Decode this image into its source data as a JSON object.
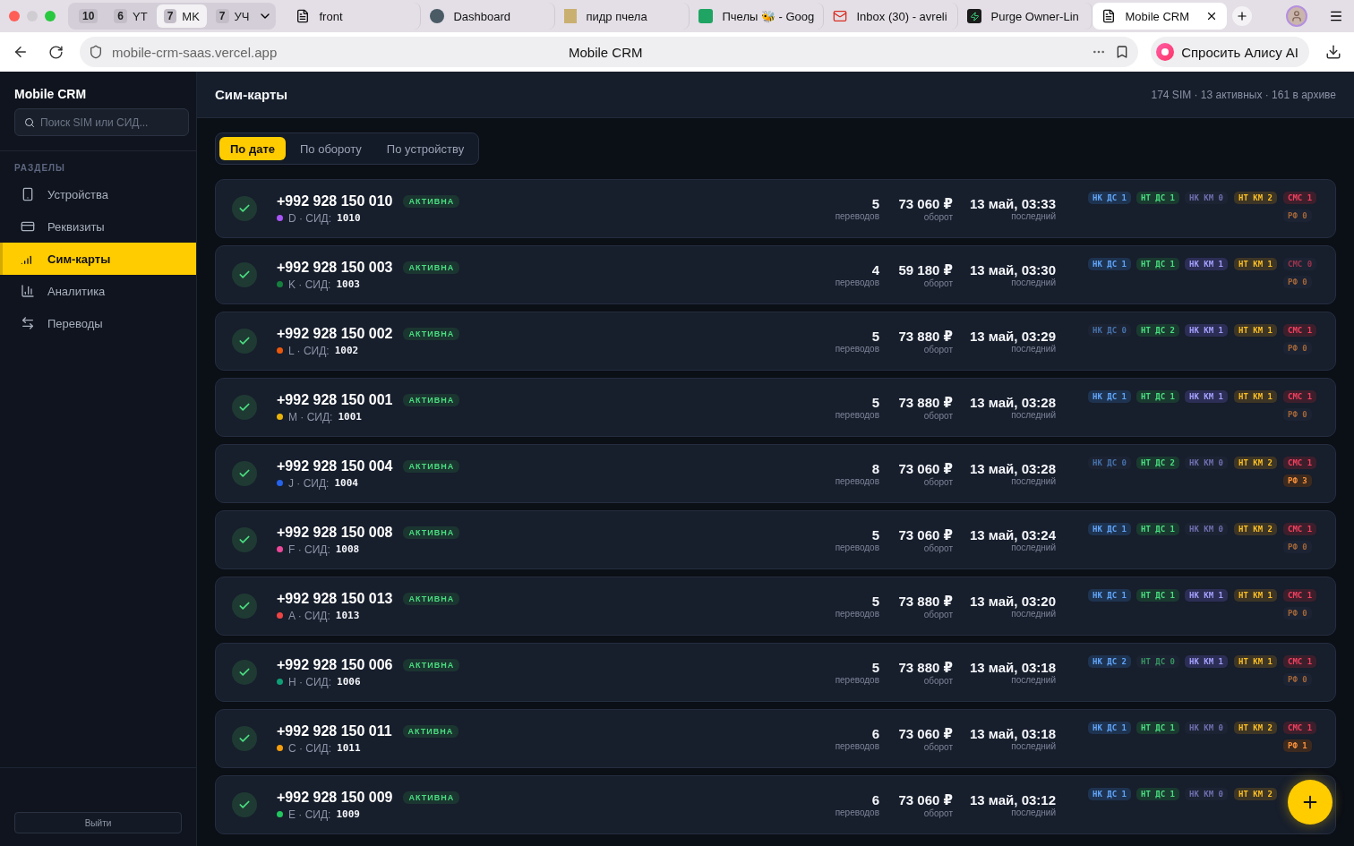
{
  "browser": {
    "tab_groups": [
      {
        "count": "10",
        "selected": false
      },
      {
        "count": "6",
        "label": "YT",
        "selected": false
      },
      {
        "count": "7",
        "label": "MK",
        "selected": true
      },
      {
        "count": "7",
        "label": "УЧ",
        "selected": false
      }
    ],
    "tabs": [
      {
        "title": "front",
        "kind": "file",
        "selected": false
      },
      {
        "title": "Dashboard",
        "kind": "circle",
        "selected": false
      },
      {
        "title": "пидр пчела",
        "kind": "photo",
        "selected": false
      },
      {
        "title": "Пчелы 🐝 - Goog",
        "kind": "sheets",
        "selected": false
      },
      {
        "title": "Inbox (30) - avreli",
        "kind": "mail",
        "selected": false
      },
      {
        "title": "Purge Owner-Lin",
        "kind": "bolt",
        "selected": false
      },
      {
        "title": "Mobile CRM",
        "kind": "file",
        "selected": true
      }
    ],
    "url": "mobile-crm-saas.vercel.app",
    "page_title": "Mobile CRM",
    "assistant_button": "Спросить Алису AI"
  },
  "sidebar": {
    "brand": "Mobile CRM",
    "search": {
      "placeholder": "Поиск SIM или СИД..."
    },
    "section": "РАЗДЕЛЫ",
    "items": [
      {
        "label": "Устройства",
        "kind": "phone",
        "selected": false
      },
      {
        "label": "Реквизиты",
        "kind": "card",
        "selected": false
      },
      {
        "label": "Сим-карты",
        "kind": "signal",
        "selected": true
      },
      {
        "label": "Аналитика",
        "kind": "chart",
        "selected": false
      },
      {
        "label": "Переводы",
        "kind": "transfer",
        "selected": false
      }
    ],
    "logout": "Выйти"
  },
  "header": {
    "title": "Сим-карты",
    "summary": "174 SIM · 13 активных · 161 в архиве"
  },
  "sort_tabs": [
    {
      "label": "По дате",
      "selected": true
    },
    {
      "label": "По обороту",
      "selected": false
    },
    {
      "label": "По устройству",
      "selected": false
    }
  ],
  "sims": [
    {
      "phone": "+992 928 150 010",
      "status": "АКТИВНА",
      "device": "D · СИД:",
      "sid": "1010",
      "color": "#a855f7",
      "transfers": "5",
      "transfers_label": "переводов",
      "turnover": "73 060 ₽",
      "turnover_label": "оборот",
      "last": "13 май, 03:33",
      "last_label": "последний",
      "tags": [
        {
          "kind": "nkds",
          "label": "НК ДС",
          "count": "1",
          "active": true
        },
        {
          "kind": "ntds",
          "label": "НТ ДС",
          "count": "1",
          "active": true
        },
        {
          "kind": "nkkm",
          "label": "НК КМ",
          "count": "0",
          "active": false
        },
        {
          "kind": "ntkm",
          "label": "НТ КМ",
          "count": "2",
          "active": true
        },
        {
          "kind": "sms",
          "label": "СМС",
          "count": "1",
          "active": true
        },
        {
          "kind": "rf",
          "label": "РФ",
          "count": "0",
          "active": false
        }
      ]
    },
    {
      "phone": "+992 928 150 003",
      "status": "АКТИВНА",
      "device": "K · СИД:",
      "sid": "1003",
      "color": "#15803d",
      "transfers": "4",
      "transfers_label": "переводов",
      "turnover": "59 180 ₽",
      "turnover_label": "оборот",
      "last": "13 май, 03:30",
      "last_label": "последний",
      "tags": [
        {
          "kind": "nkds",
          "label": "НК ДС",
          "count": "1",
          "active": true
        },
        {
          "kind": "ntds",
          "label": "НТ ДС",
          "count": "1",
          "active": true
        },
        {
          "kind": "nkkm",
          "label": "НК КМ",
          "count": "1",
          "active": true
        },
        {
          "kind": "ntkm",
          "label": "НТ КМ",
          "count": "1",
          "active": true
        },
        {
          "kind": "sms",
          "label": "СМС",
          "count": "0",
          "active": false
        },
        {
          "kind": "rf",
          "label": "РФ",
          "count": "0",
          "active": false
        }
      ]
    },
    {
      "phone": "+992 928 150 002",
      "status": "АКТИВНА",
      "device": "L · СИД:",
      "sid": "1002",
      "color": "#ea580c",
      "transfers": "5",
      "transfers_label": "переводов",
      "turnover": "73 880 ₽",
      "turnover_label": "оборот",
      "last": "13 май, 03:29",
      "last_label": "последний",
      "tags": [
        {
          "kind": "nkds",
          "label": "НК ДС",
          "count": "0",
          "active": false
        },
        {
          "kind": "ntds",
          "label": "НТ ДС",
          "count": "2",
          "active": true
        },
        {
          "kind": "nkkm",
          "label": "НК КМ",
          "count": "1",
          "active": true
        },
        {
          "kind": "ntkm",
          "label": "НТ КМ",
          "count": "1",
          "active": true
        },
        {
          "kind": "sms",
          "label": "СМС",
          "count": "1",
          "active": true
        },
        {
          "kind": "rf",
          "label": "РФ",
          "count": "0",
          "active": false
        }
      ]
    },
    {
      "phone": "+992 928 150 001",
      "status": "АКТИВНА",
      "device": "M · СИД:",
      "sid": "1001",
      "color": "#eab308",
      "transfers": "5",
      "transfers_label": "переводов",
      "turnover": "73 880 ₽",
      "turnover_label": "оборот",
      "last": "13 май, 03:28",
      "last_label": "последний",
      "tags": [
        {
          "kind": "nkds",
          "label": "НК ДС",
          "count": "1",
          "active": true
        },
        {
          "kind": "ntds",
          "label": "НТ ДС",
          "count": "1",
          "active": true
        },
        {
          "kind": "nkkm",
          "label": "НК КМ",
          "count": "1",
          "active": true
        },
        {
          "kind": "ntkm",
          "label": "НТ КМ",
          "count": "1",
          "active": true
        },
        {
          "kind": "sms",
          "label": "СМС",
          "count": "1",
          "active": true
        },
        {
          "kind": "rf",
          "label": "РФ",
          "count": "0",
          "active": false
        }
      ]
    },
    {
      "phone": "+992 928 150 004",
      "status": "АКТИВНА",
      "device": "J · СИД:",
      "sid": "1004",
      "color": "#2563eb",
      "transfers": "8",
      "transfers_label": "переводов",
      "turnover": "73 060 ₽",
      "turnover_label": "оборот",
      "last": "13 май, 03:28",
      "last_label": "последний",
      "tags": [
        {
          "kind": "nkds",
          "label": "НК ДС",
          "count": "0",
          "active": false
        },
        {
          "kind": "ntds",
          "label": "НТ ДС",
          "count": "2",
          "active": true
        },
        {
          "kind": "nkkm",
          "label": "НК КМ",
          "count": "0",
          "active": false
        },
        {
          "kind": "ntkm",
          "label": "НТ КМ",
          "count": "2",
          "active": true
        },
        {
          "kind": "sms",
          "label": "СМС",
          "count": "1",
          "active": true
        },
        {
          "kind": "rf",
          "label": "РФ",
          "count": "3",
          "active": true
        }
      ]
    },
    {
      "phone": "+992 928 150 008",
      "status": "АКТИВНА",
      "device": "F · СИД:",
      "sid": "1008",
      "color": "#ec4899",
      "transfers": "5",
      "transfers_label": "переводов",
      "turnover": "73 060 ₽",
      "turnover_label": "оборот",
      "last": "13 май, 03:24",
      "last_label": "последний",
      "tags": [
        {
          "kind": "nkds",
          "label": "НК ДС",
          "count": "1",
          "active": true
        },
        {
          "kind": "ntds",
          "label": "НТ ДС",
          "count": "1",
          "active": true
        },
        {
          "kind": "nkkm",
          "label": "НК КМ",
          "count": "0",
          "active": false
        },
        {
          "kind": "ntkm",
          "label": "НТ КМ",
          "count": "2",
          "active": true
        },
        {
          "kind": "sms",
          "label": "СМС",
          "count": "1",
          "active": true
        },
        {
          "kind": "rf",
          "label": "РФ",
          "count": "0",
          "active": false
        }
      ]
    },
    {
      "phone": "+992 928 150 013",
      "status": "АКТИВНА",
      "device": "A · СИД:",
      "sid": "1013",
      "color": "#ef4444",
      "transfers": "5",
      "transfers_label": "переводов",
      "turnover": "73 880 ₽",
      "turnover_label": "оборот",
      "last": "13 май, 03:20",
      "last_label": "последний",
      "tags": [
        {
          "kind": "nkds",
          "label": "НК ДС",
          "count": "1",
          "active": true
        },
        {
          "kind": "ntds",
          "label": "НТ ДС",
          "count": "1",
          "active": true
        },
        {
          "kind": "nkkm",
          "label": "НК КМ",
          "count": "1",
          "active": true
        },
        {
          "kind": "ntkm",
          "label": "НТ КМ",
          "count": "1",
          "active": true
        },
        {
          "kind": "sms",
          "label": "СМС",
          "count": "1",
          "active": true
        },
        {
          "kind": "rf",
          "label": "РФ",
          "count": "0",
          "active": false
        }
      ]
    },
    {
      "phone": "+992 928 150 006",
      "status": "АКТИВНА",
      "device": "H · СИД:",
      "sid": "1006",
      "color": "#0f9d76",
      "transfers": "5",
      "transfers_label": "переводов",
      "turnover": "73 880 ₽",
      "turnover_label": "оборот",
      "last": "13 май, 03:18",
      "last_label": "последний",
      "tags": [
        {
          "kind": "nkds",
          "label": "НК ДС",
          "count": "2",
          "active": true
        },
        {
          "kind": "ntds",
          "label": "НТ ДС",
          "count": "0",
          "active": false
        },
        {
          "kind": "nkkm",
          "label": "НК КМ",
          "count": "1",
          "active": true
        },
        {
          "kind": "ntkm",
          "label": "НТ КМ",
          "count": "1",
          "active": true
        },
        {
          "kind": "sms",
          "label": "СМС",
          "count": "1",
          "active": true
        },
        {
          "kind": "rf",
          "label": "РФ",
          "count": "0",
          "active": false
        }
      ]
    },
    {
      "phone": "+992 928 150 011",
      "status": "АКТИВНА",
      "device": "C · СИД:",
      "sid": "1011",
      "color": "#f59e0b",
      "transfers": "6",
      "transfers_label": "переводов",
      "turnover": "73 060 ₽",
      "turnover_label": "оборот",
      "last": "13 май, 03:18",
      "last_label": "последний",
      "tags": [
        {
          "kind": "nkds",
          "label": "НК ДС",
          "count": "1",
          "active": true
        },
        {
          "kind": "ntds",
          "label": "НТ ДС",
          "count": "1",
          "active": true
        },
        {
          "kind": "nkkm",
          "label": "НК КМ",
          "count": "0",
          "active": false
        },
        {
          "kind": "ntkm",
          "label": "НТ КМ",
          "count": "2",
          "active": true
        },
        {
          "kind": "sms",
          "label": "СМС",
          "count": "1",
          "active": true
        },
        {
          "kind": "rf",
          "label": "РФ",
          "count": "1",
          "active": true
        }
      ]
    },
    {
      "phone": "+992 928 150 009",
      "status": "АКТИВНА",
      "device": "E · СИД:",
      "sid": "1009",
      "color": "#22c55e",
      "transfers": "6",
      "transfers_label": "переводов",
      "turnover": "73 060 ₽",
      "turnover_label": "оборот",
      "last": "13 май, 03:12",
      "last_label": "последний",
      "tags": [
        {
          "kind": "nkds",
          "label": "НК ДС",
          "count": "1",
          "active": true
        },
        {
          "kind": "ntds",
          "label": "НТ ДС",
          "count": "1",
          "active": true
        },
        {
          "kind": "nkkm",
          "label": "НК КМ",
          "count": "0",
          "active": false
        },
        {
          "kind": "ntkm",
          "label": "НТ КМ",
          "count": "2",
          "active": true
        }
      ]
    }
  ]
}
